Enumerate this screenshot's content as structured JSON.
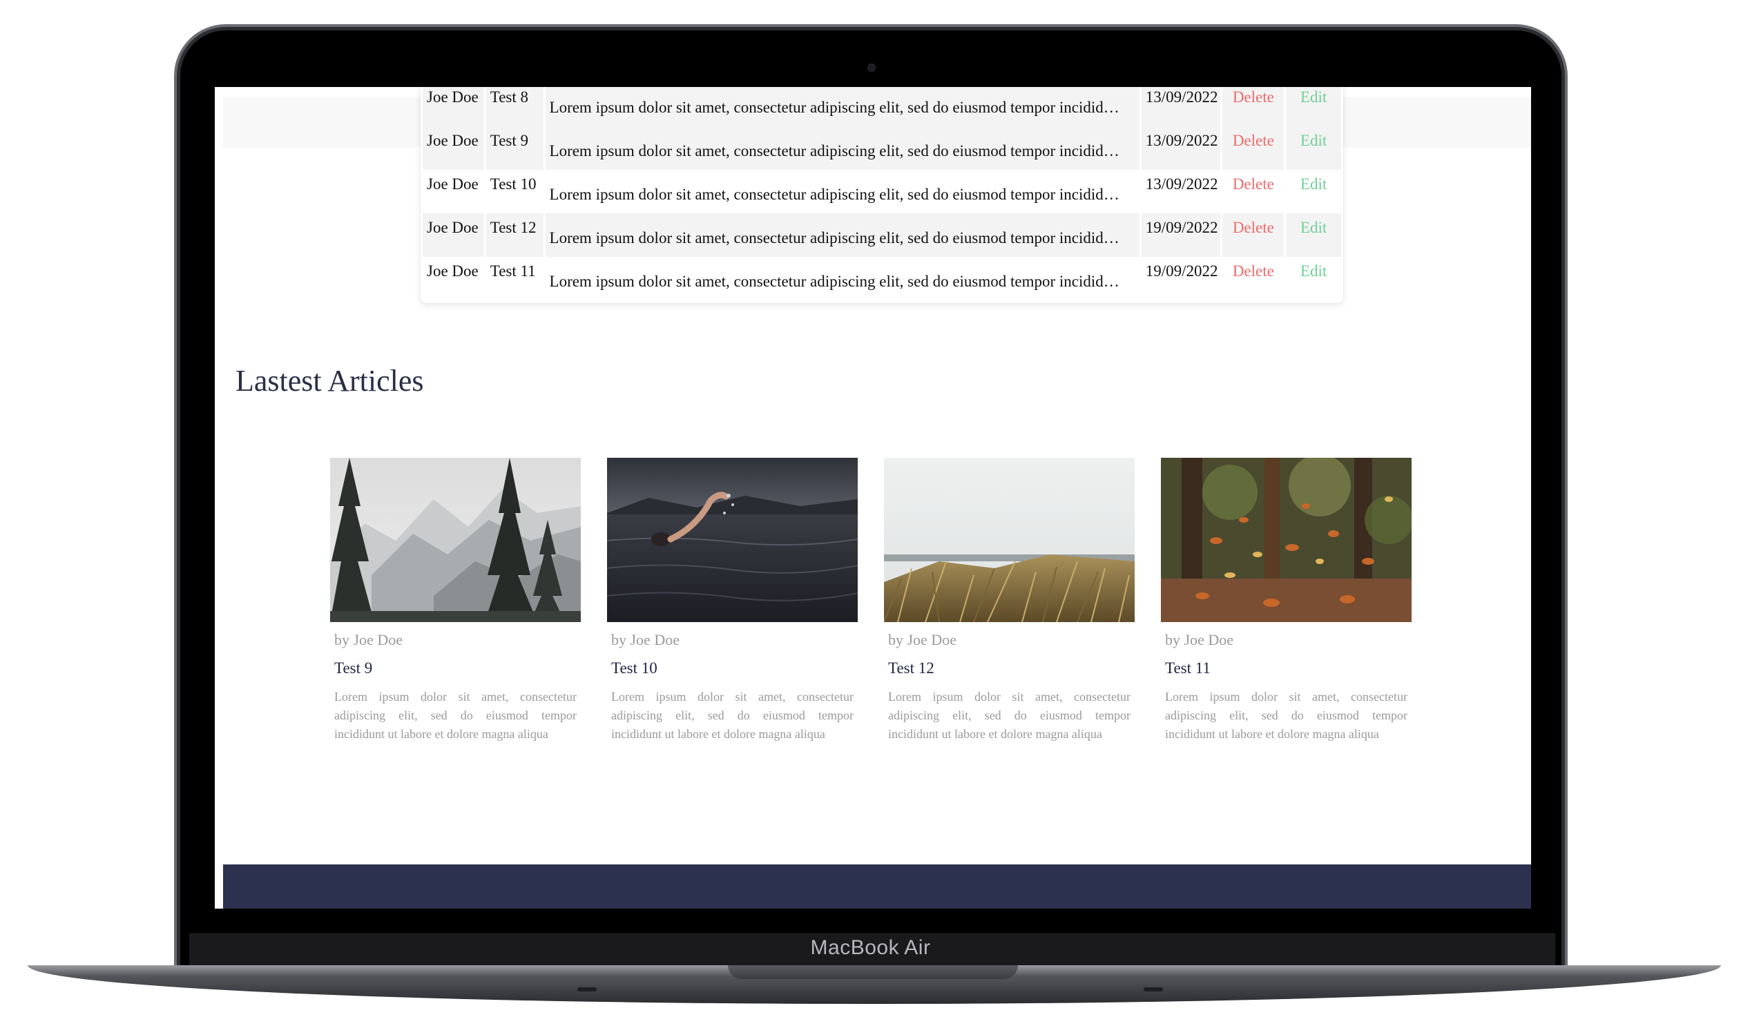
{
  "device": {
    "label": "MacBook Air"
  },
  "posts_table": {
    "rows": [
      {
        "author": "Joe Doe",
        "title": "Test 8",
        "body": "Lorem ipsum dolor sit amet, consectetur adipiscing elit, sed do eiusmod tempor incidid…",
        "date": "13/09/2022",
        "delete": "Delete",
        "edit": "Edit"
      },
      {
        "author": "Joe Doe",
        "title": "Test 9",
        "body": "Lorem ipsum dolor sit amet, consectetur adipiscing elit, sed do eiusmod tempor incidid…",
        "date": "13/09/2022",
        "delete": "Delete",
        "edit": "Edit"
      },
      {
        "author": "Joe Doe",
        "title": "Test 10",
        "body": "Lorem ipsum dolor sit amet, consectetur adipiscing elit, sed do eiusmod tempor incidid…",
        "date": "13/09/2022",
        "delete": "Delete",
        "edit": "Edit"
      },
      {
        "author": "Joe Doe",
        "title": "Test 12",
        "body": "Lorem ipsum dolor sit amet, consectetur adipiscing elit, sed do eiusmod tempor incidid…",
        "date": "19/09/2022",
        "delete": "Delete",
        "edit": "Edit"
      },
      {
        "author": "Joe Doe",
        "title": "Test 11",
        "body": "Lorem ipsum dolor sit amet, consectetur adipiscing elit, sed do eiusmod tempor incidid…",
        "date": "19/09/2022",
        "delete": "Delete",
        "edit": "Edit"
      }
    ]
  },
  "latest": {
    "heading": "Lastest Articles",
    "articles": [
      {
        "image": "snowy-mountain-pines-photo",
        "author": "by Joe Doe",
        "title": "Test 9",
        "excerpt": "Lorem ipsum dolor sit amet, consectetur adipiscing elit, sed do eiusmod tempor incididunt ut labore et dolore magna aliqua"
      },
      {
        "image": "swimmer-in-lake-photo",
        "author": "by Joe Doe",
        "title": "Test 10",
        "excerpt": "Lorem ipsum dolor sit amet, consectetur adipiscing elit, sed do eiusmod tempor incididunt ut labore et dolore magna aliqua"
      },
      {
        "image": "beach-dune-grass-photo",
        "author": "by Joe Doe",
        "title": "Test 12",
        "excerpt": "Lorem ipsum dolor sit amet, consectetur adipiscing elit, sed do eiusmod tempor incididunt ut labore et dolore magna aliqua"
      },
      {
        "image": "autumn-falling-leaves-photo",
        "author": "by Joe Doe",
        "title": "Test 11",
        "excerpt": "Lorem ipsum dolor sit amet, consectetur adipiscing elit, sed do eiusmod tempor incididunt ut labore et dolore magna aliqua"
      }
    ]
  },
  "colors": {
    "delete": "#ec6b6b",
    "edit": "#6fcf97",
    "heading": "#2a2f45",
    "footer": "#2c3150",
    "muted_text": "#9a9a9a"
  }
}
